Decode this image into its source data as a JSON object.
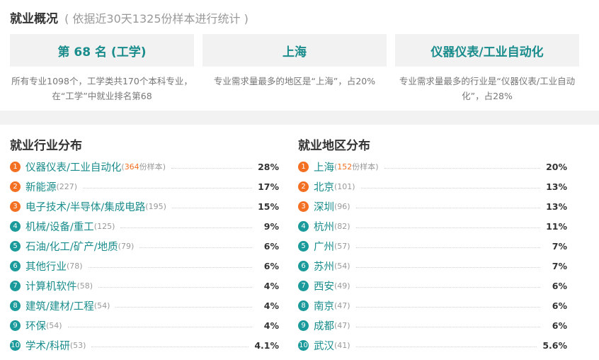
{
  "overview": {
    "title": "就业概况",
    "subtitle": "( 依据近30天1325份样本进行统计 )",
    "cards": [
      {
        "value": "第 68 名 (工学)",
        "desc": "所有专业1098个，工学类共170个本科专业，在“工学”中就业排名第68"
      },
      {
        "value": "上海",
        "desc": "专业需求量最多的地区是“上海”，占20%"
      },
      {
        "value": "仪器仪表/工业自动化",
        "desc": "专业需求量最多的行业是“仪器仪表/工业自动化”，占28%"
      }
    ]
  },
  "industry": {
    "title": "就业行业分布",
    "items": [
      {
        "rank": "1",
        "name": "仪器仪表/工业自动化",
        "count": "364",
        "count_suffix": "份样本",
        "pct": "28%"
      },
      {
        "rank": "2",
        "name": "新能源",
        "count": "(227)",
        "pct": "17%"
      },
      {
        "rank": "3",
        "name": "电子技术/半导体/集成电路",
        "count": "(195)",
        "pct": "15%"
      },
      {
        "rank": "4",
        "name": "机械/设备/重工",
        "count": "(125)",
        "pct": "9%"
      },
      {
        "rank": "5",
        "name": "石油/化工/矿产/地质",
        "count": "(79)",
        "pct": "6%"
      },
      {
        "rank": "6",
        "name": "其他行业",
        "count": "(78)",
        "pct": "6%"
      },
      {
        "rank": "7",
        "name": "计算机软件",
        "count": "(58)",
        "pct": "4%"
      },
      {
        "rank": "8",
        "name": "建筑/建材/工程",
        "count": "(54)",
        "pct": "4%"
      },
      {
        "rank": "9",
        "name": "环保",
        "count": "(54)",
        "pct": "4%"
      },
      {
        "rank": "10",
        "name": "学术/科研",
        "count": "(53)",
        "pct": "4.1%"
      }
    ]
  },
  "region": {
    "title": "就业地区分布",
    "items": [
      {
        "rank": "1",
        "name": "上海",
        "count": "152",
        "count_suffix": "份样本",
        "pct": "20%"
      },
      {
        "rank": "2",
        "name": "北京",
        "count": "(101)",
        "pct": "13%"
      },
      {
        "rank": "3",
        "name": "深圳",
        "count": "(96)",
        "pct": "13%"
      },
      {
        "rank": "4",
        "name": "杭州",
        "count": "(82)",
        "pct": "11%"
      },
      {
        "rank": "5",
        "name": "广州",
        "count": "(57)",
        "pct": "7%"
      },
      {
        "rank": "6",
        "name": "苏州",
        "count": "(54)",
        "pct": "7%"
      },
      {
        "rank": "7",
        "name": "西安",
        "count": "(49)",
        "pct": "6%"
      },
      {
        "rank": "8",
        "name": "南京",
        "count": "(47)",
        "pct": "6%"
      },
      {
        "rank": "9",
        "name": "成都",
        "count": "(47)",
        "pct": "6%"
      },
      {
        "rank": "10",
        "name": "武汉",
        "count": "(41)",
        "pct": "5.6%"
      }
    ]
  },
  "colors": {
    "accent": "#1a8c8c",
    "hot_rank": "#f36f21",
    "rank": "#1a9a9a"
  }
}
